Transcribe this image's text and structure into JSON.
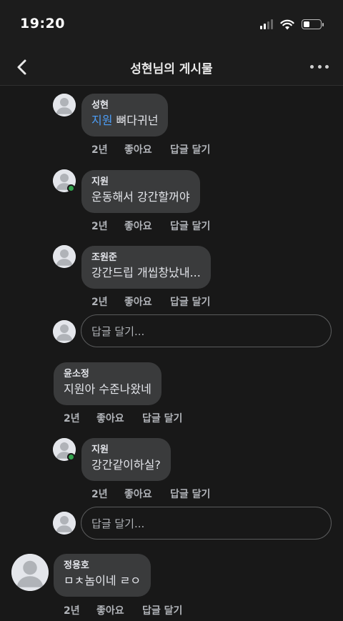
{
  "status": {
    "time": "19:20"
  },
  "header": {
    "title": "성현님의 게시물"
  },
  "comments": [
    {
      "author": "성현",
      "mention": "지원",
      "text": " 뼈다귀넌",
      "time": "2년",
      "like": "좋아요",
      "reply": "답글 달기"
    },
    {
      "author": "지원",
      "text": "운동해서 강간할꺼야",
      "time": "2년",
      "like": "좋아요",
      "reply": "답글 달기"
    },
    {
      "author": "조원준",
      "text": "강간드립 개씹창났내...",
      "time": "2년",
      "like": "좋아요",
      "reply": "답글 달기"
    },
    {
      "author": "윤소정",
      "text": "지원아 수준나왔네",
      "time": "2년",
      "like": "좋아요",
      "reply": "답글 달기"
    },
    {
      "author": "지원",
      "text": "강간같이하실?",
      "time": "2년",
      "like": "좋아요",
      "reply": "답글 달기"
    },
    {
      "author": "정용호",
      "text": "ㅁㅊ놈이네 ㄹㅇ",
      "time": "2년",
      "like": "좋아요",
      "reply": "답글 달기"
    }
  ],
  "reply_box": {
    "placeholder": "답글 달기..."
  },
  "colors": {
    "background": "#181818",
    "bubble": "#3a3b3c",
    "mention": "#4d9ef7",
    "online": "#31a24c"
  },
  "icons": [
    "back-arrow-icon",
    "more-dots-icon",
    "signal-icon",
    "wifi-icon",
    "battery-icon",
    "default-avatar-icon",
    "online-status-icon"
  ]
}
